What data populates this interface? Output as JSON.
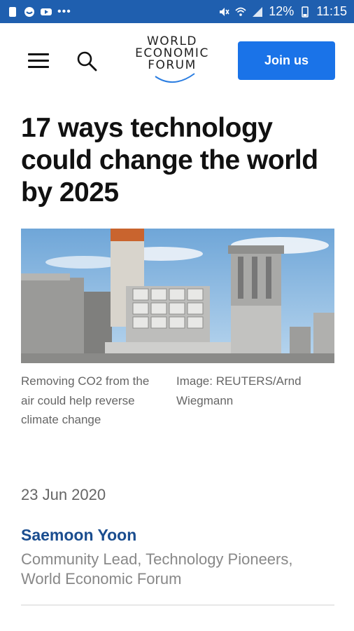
{
  "status_bar": {
    "battery": "12%",
    "time": "11:15",
    "colors": {
      "bar": "#1f5faf"
    }
  },
  "header": {
    "logo_lines": [
      "WORLD",
      "ECONOMIC",
      "FORUM"
    ],
    "join_label": "Join us",
    "colors": {
      "join_bg": "#1a73e8"
    }
  },
  "article": {
    "title": "17 ways technology could change the world by 2025",
    "image_caption": "Removing CO2 from the air could help reverse climate change",
    "image_credit": "Image: REUTERS/Arnd Wiegmann",
    "date": "23 Jun 2020",
    "author": "Saemoon Yoon",
    "author_role": "Community Lead, Technology Pioneers, World Economic Forum",
    "colors": {
      "author": "#1a4d8f"
    }
  }
}
